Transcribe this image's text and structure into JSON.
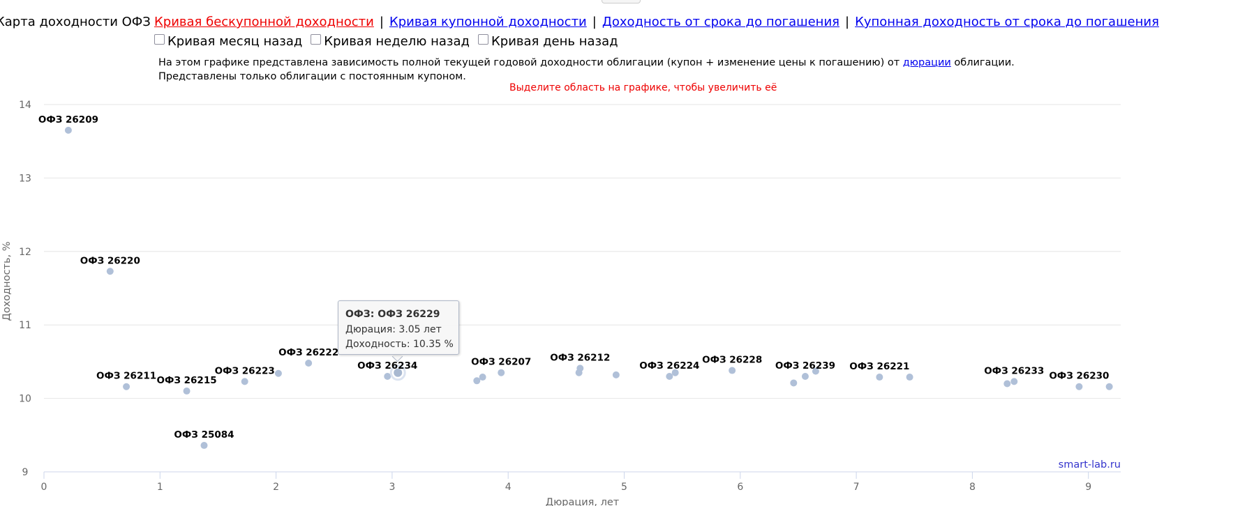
{
  "header": {
    "title": "Карта доходности ОФЗ",
    "nav": [
      {
        "label": "Кривая бескупонной доходности",
        "active": true
      },
      {
        "label": "Кривая купонной доходности",
        "active": false
      },
      {
        "label": "Доходность от срока до погашения",
        "active": false
      },
      {
        "label": "Купонная доходность от срока до погашения",
        "active": false
      }
    ],
    "separator": "|",
    "checkboxes": [
      "Кривая месяц назад",
      "Кривая неделю назад",
      "Кривая день назад"
    ]
  },
  "description": {
    "line1_before": "На этом графике представлена зависимость полной текущей годовой доходности облигации (купон + изменение цены к погашению) от ",
    "line1_link": "дюрации",
    "line1_after": " облигации.",
    "line2": "Представлены только облигации с постоянным купоном.",
    "zoom_hint": "Выделите область на графике, чтобы увеличить её"
  },
  "chart_data": {
    "type": "scatter",
    "xlabel": "Дюрация, лет",
    "ylabel": "Доходность, %",
    "xlim": [
      0,
      9.3
    ],
    "ylim": [
      9,
      14
    ],
    "x_ticks": [
      0,
      1,
      2,
      3,
      4,
      5,
      6,
      7,
      8,
      9
    ],
    "y_ticks": [
      9,
      10,
      11,
      12,
      13,
      14
    ],
    "grid": true,
    "point_color": "#b0c0d8",
    "credit": "smart-lab.ru",
    "points": [
      {
        "x": 0.21,
        "y": 13.65,
        "label": "ОФЗ 26209"
      },
      {
        "x": 0.57,
        "y": 11.73,
        "label": "ОФЗ 26220"
      },
      {
        "x": 0.71,
        "y": 10.16,
        "label": "ОФЗ 26211"
      },
      {
        "x": 1.23,
        "y": 10.1,
        "label": "ОФЗ 26215"
      },
      {
        "x": 1.38,
        "y": 9.36,
        "label": "ОФЗ 25084"
      },
      {
        "x": 1.73,
        "y": 10.23,
        "label": "ОФЗ 26223"
      },
      {
        "x": 2.02,
        "y": 10.34,
        "label": ""
      },
      {
        "x": 2.28,
        "y": 10.48,
        "label": "ОФЗ 26222"
      },
      {
        "x": 2.96,
        "y": 10.3,
        "label": "ОФЗ 26234"
      },
      {
        "x": 3.05,
        "y": 10.35,
        "label": ""
      },
      {
        "x": 3.73,
        "y": 10.24,
        "label": ""
      },
      {
        "x": 3.78,
        "y": 10.29,
        "label": ""
      },
      {
        "x": 3.94,
        "y": 10.35,
        "label": "ОФЗ 26207"
      },
      {
        "x": 4.61,
        "y": 10.35,
        "label": ""
      },
      {
        "x": 4.62,
        "y": 10.41,
        "label": "ОФЗ 26212"
      },
      {
        "x": 4.93,
        "y": 10.32,
        "label": ""
      },
      {
        "x": 5.39,
        "y": 10.3,
        "label": "ОФЗ 26224"
      },
      {
        "x": 5.44,
        "y": 10.35,
        "label": ""
      },
      {
        "x": 5.93,
        "y": 10.38,
        "label": "ОФЗ 26228"
      },
      {
        "x": 6.46,
        "y": 10.21,
        "label": ""
      },
      {
        "x": 6.56,
        "y": 10.3,
        "label": "ОФЗ 26239"
      },
      {
        "x": 6.65,
        "y": 10.37,
        "label": ""
      },
      {
        "x": 7.2,
        "y": 10.29,
        "label": "ОФЗ 26221"
      },
      {
        "x": 7.46,
        "y": 10.29,
        "label": ""
      },
      {
        "x": 8.3,
        "y": 10.2,
        "label": ""
      },
      {
        "x": 8.36,
        "y": 10.23,
        "label": "ОФЗ 26233"
      },
      {
        "x": 8.92,
        "y": 10.16,
        "label": "ОФЗ 26230"
      },
      {
        "x": 9.18,
        "y": 10.16,
        "label": ""
      }
    ],
    "tooltip": {
      "title": "ОФЗ: ОФЗ 26229",
      "duration": "Дюрация: 3.05 лет",
      "yield": "Доходность: 10.35 %"
    }
  }
}
